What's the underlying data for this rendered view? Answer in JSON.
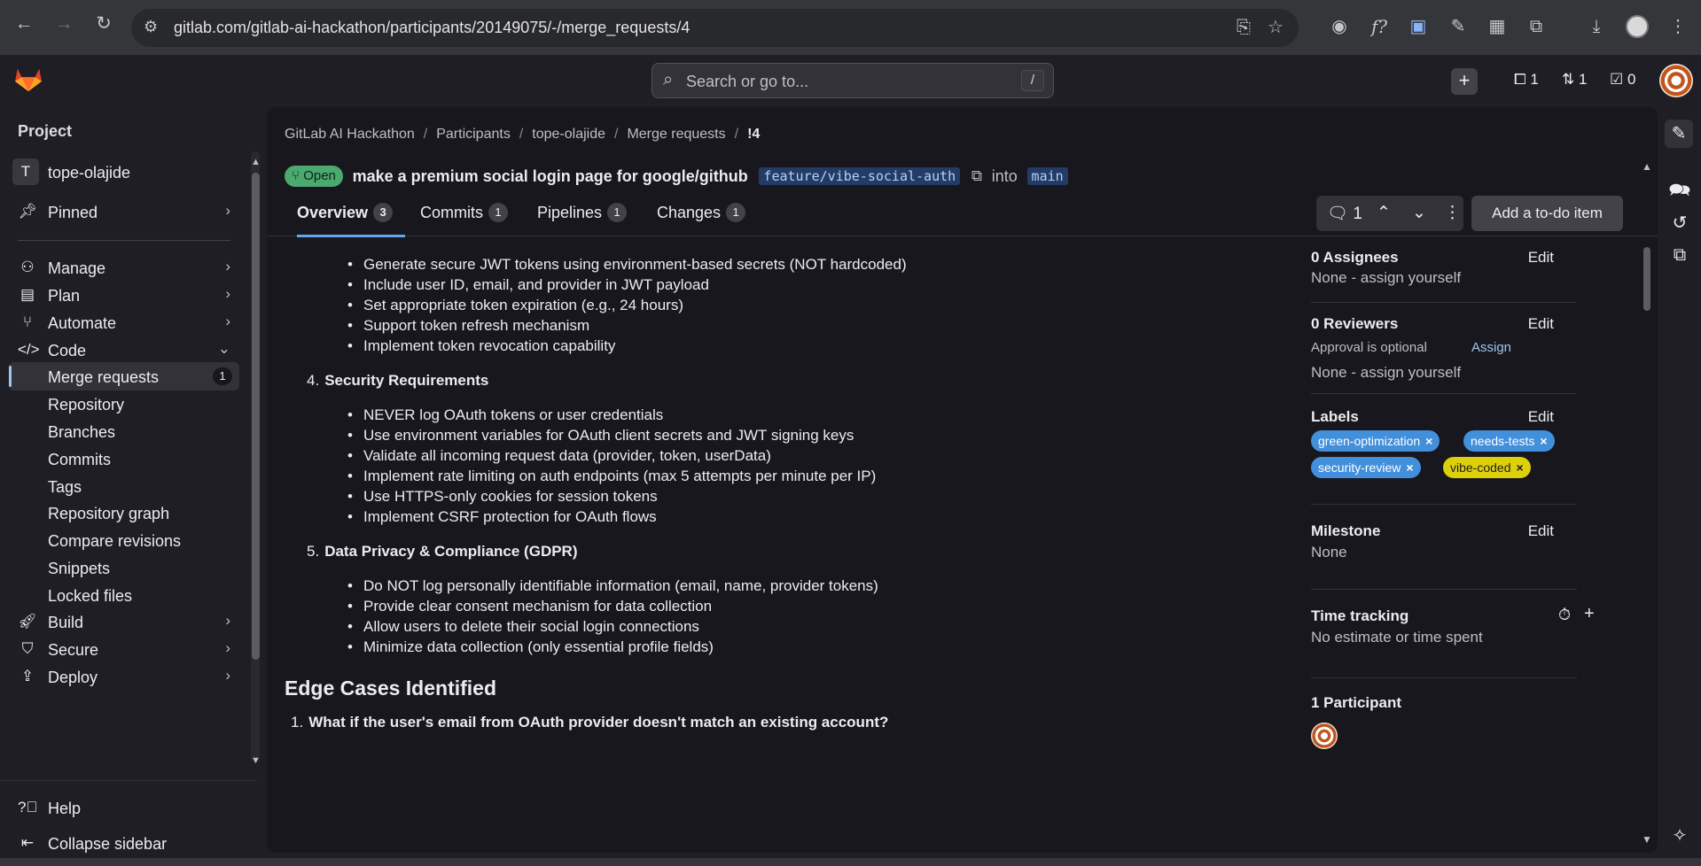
{
  "browser": {
    "url": "gitlab.com/gitlab-ai-hackathon/participants/20149075/-/merge_requests/4"
  },
  "topbar": {
    "search_placeholder": "Search or go to...",
    "search_shortcut": "/",
    "mr_count": "1",
    "review_count": "1",
    "todo_count": "0"
  },
  "sidebar": {
    "section_title": "Project",
    "project_initial": "T",
    "project_name": "tope-olajide",
    "pinned": "Pinned",
    "items": [
      {
        "label": "Manage"
      },
      {
        "label": "Plan"
      },
      {
        "label": "Automate"
      },
      {
        "label": "Code"
      },
      {
        "label": "Merge requests",
        "badge": "1"
      },
      {
        "label": "Repository"
      },
      {
        "label": "Branches"
      },
      {
        "label": "Commits"
      },
      {
        "label": "Tags"
      },
      {
        "label": "Repository graph"
      },
      {
        "label": "Compare revisions"
      },
      {
        "label": "Snippets"
      },
      {
        "label": "Locked files"
      },
      {
        "label": "Build"
      },
      {
        "label": "Secure"
      },
      {
        "label": "Deploy"
      }
    ],
    "help": "Help",
    "collapse": "Collapse sidebar"
  },
  "breadcrumb": {
    "items": [
      "GitLab AI Hackathon",
      "Participants",
      "tope-olajide",
      "Merge requests",
      "!4"
    ]
  },
  "mr": {
    "status": "Open",
    "title": "make a premium social login page for google/github",
    "source_branch": "feature/vibe-social-auth",
    "into": "into",
    "target_branch": "main"
  },
  "tabs": [
    {
      "label": "Overview",
      "count": "3"
    },
    {
      "label": "Commits",
      "count": "1"
    },
    {
      "label": "Pipelines",
      "count": "1"
    },
    {
      "label": "Changes",
      "count": "1"
    }
  ],
  "toolbar": {
    "comments_count": "1",
    "todo_button": "Add a to-do item"
  },
  "description": {
    "list_a": [
      "Generate secure JWT tokens using environment-based secrets (NOT hardcoded)",
      "Include user ID, email, and provider in JWT payload",
      "Set appropriate token expiration (e.g., 24 hours)",
      "Support token refresh mechanism",
      "Implement token revocation capability"
    ],
    "heading_4_num": "4.",
    "heading_4": "Security Requirements",
    "list_b": [
      "NEVER log OAuth tokens or user credentials",
      "Use environment variables for OAuth client secrets and JWT signing keys",
      "Validate all incoming request data (provider, token, userData)",
      "Implement rate limiting on auth endpoints (max 5 attempts per minute per IP)",
      "Use HTTPS-only cookies for session tokens",
      "Implement CSRF protection for OAuth flows"
    ],
    "heading_5_num": "5.",
    "heading_5": "Data Privacy & Compliance (GDPR)",
    "list_c": [
      "Do NOT log personally identifiable information (email, name, provider tokens)",
      "Provide clear consent mechanism for data collection",
      "Allow users to delete their social login connections",
      "Minimize data collection (only essential profile fields)"
    ],
    "section_title": "Edge Cases Identified",
    "edge_1_num": "1.",
    "edge_1": "What if the user's email from OAuth provider doesn't match an existing account?"
  },
  "right_panel": {
    "assignees_title": "0 Assignees",
    "assignees_value": "None - assign yourself",
    "reviewers_title": "0 Reviewers",
    "approval_text": "Approval is optional",
    "assign_link": "Assign",
    "reviewers_value": "None - assign yourself",
    "labels_title": "Labels",
    "labels": [
      {
        "name": "green-optimization",
        "color": "#428fdc"
      },
      {
        "name": "needs-tests",
        "color": "#428fdc"
      },
      {
        "name": "security-review",
        "color": "#428fdc"
      },
      {
        "name": "vibe-coded",
        "color": "#ddd00b"
      }
    ],
    "milestone_title": "Milestone",
    "milestone_value": "None",
    "time_title": "Time tracking",
    "time_value": "No estimate or time spent",
    "participants_title": "1 Participant",
    "edit": "Edit"
  }
}
